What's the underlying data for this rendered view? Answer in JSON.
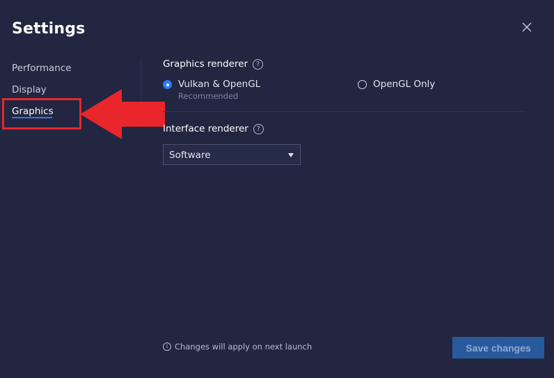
{
  "window": {
    "title": "Settings"
  },
  "sidebar": {
    "items": [
      {
        "label": "Performance"
      },
      {
        "label": "Display"
      },
      {
        "label": "Graphics"
      }
    ],
    "active_index": 2
  },
  "graphics_renderer": {
    "label": "Graphics renderer",
    "help_icon": "question-circle-icon",
    "options": [
      {
        "label": "Vulkan & OpenGL",
        "sublabel": "Recommended",
        "selected": true
      },
      {
        "label": "OpenGL Only",
        "selected": false
      }
    ]
  },
  "interface_renderer": {
    "label": "Interface renderer",
    "help_icon": "question-circle-icon",
    "selected": "Software"
  },
  "footer": {
    "note": "Changes will apply on next launch",
    "note_icon": "info-icon",
    "save_label": "Save changes"
  },
  "annotation": {
    "highlight_color": "#e8262b",
    "arrow_color": "#e8262b"
  },
  "colors": {
    "background": "#222641",
    "accent": "#2c7bf2",
    "button_disabled": "#2a5a9e"
  }
}
